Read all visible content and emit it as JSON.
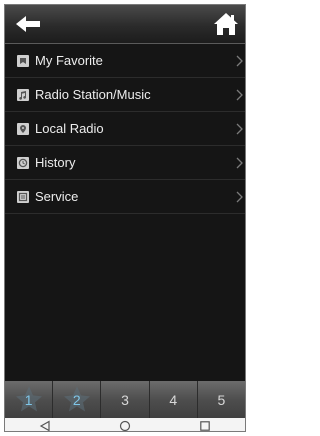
{
  "menu": {
    "items": [
      {
        "label": "My Favorite",
        "icon": "favorite-icon"
      },
      {
        "label": "Radio Station/Music",
        "icon": "music-note-icon"
      },
      {
        "label": "Local Radio",
        "icon": "location-pin-icon"
      },
      {
        "label": "History",
        "icon": "clock-icon"
      },
      {
        "label": "Service",
        "icon": "service-icon"
      }
    ]
  },
  "presets": {
    "buttons": [
      {
        "label": "1",
        "active": true
      },
      {
        "label": "2",
        "active": true
      },
      {
        "label": "3",
        "active": false
      },
      {
        "label": "4",
        "active": false
      },
      {
        "label": "5",
        "active": false
      }
    ]
  },
  "colors": {
    "background": "#151515",
    "text": "#ededed",
    "active_preset_number": "#7fc6e8"
  }
}
